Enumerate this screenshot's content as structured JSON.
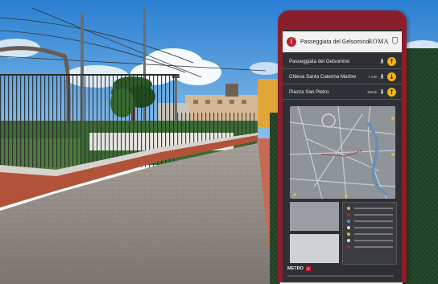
{
  "sign": {
    "title": "Passeggiata del Gelsomino",
    "city": "ROMA",
    "destinations": [
      {
        "name": "Passeggiata del Gelsomino",
        "time": "",
        "arrow": "↑"
      },
      {
        "name": "Chiesa Santa Caterina Martire",
        "time": "7 min",
        "arrow": "↓"
      },
      {
        "name": "Piazza San Pietro",
        "time": "15min",
        "arrow": "↑"
      }
    ],
    "metro_label": "METRO",
    "metro_line": "A"
  },
  "colors": {
    "sky": "#3f8fd8",
    "sign_frame": "#8a1f2b",
    "sign_panel": "#2e3036",
    "arrow_badge": "#f0b21d",
    "brick_wall": "#b0533a",
    "paving": "#8f8a84"
  },
  "icons": [
    "info-icon",
    "crest-icon",
    "walk-icon",
    "arrow-up-icon",
    "arrow-down-icon",
    "metro-icon"
  ]
}
